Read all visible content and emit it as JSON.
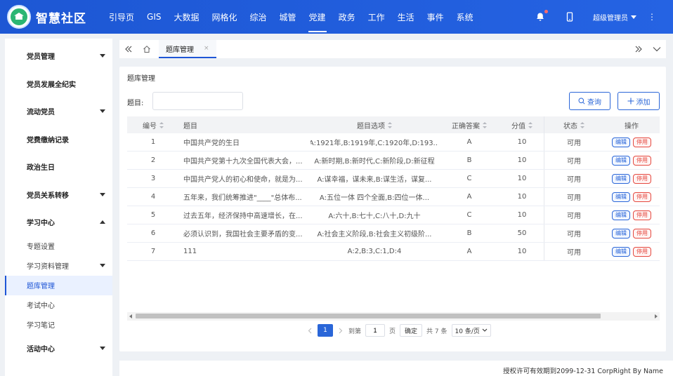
{
  "header": {
    "title": "智慧社区",
    "nav": [
      "引导页",
      "GIS",
      "大数据",
      "网格化",
      "综治",
      "城管",
      "党建",
      "政务",
      "工作",
      "生活",
      "事件",
      "系统"
    ],
    "active_nav": "党建",
    "user": "超级管理员",
    "more": "⋮"
  },
  "sidebar": {
    "items": [
      {
        "label": "党员管理",
        "type": "main",
        "arrow": "down"
      },
      {
        "label": "党员发展全纪实",
        "type": "main"
      },
      {
        "label": "流动党员",
        "type": "main",
        "arrow": "down"
      },
      {
        "label": "党费缴纳记录",
        "type": "main"
      },
      {
        "label": "政治生日",
        "type": "main"
      },
      {
        "label": "党员关系转移",
        "type": "main",
        "arrow": "down"
      },
      {
        "label": "学习中心",
        "type": "main",
        "arrow": "up"
      },
      {
        "label": "专题设置",
        "type": "sub"
      },
      {
        "label": "学习资料管理",
        "type": "sub",
        "arrow": "down"
      },
      {
        "label": "题库管理",
        "type": "sub",
        "active": true
      },
      {
        "label": "考试中心",
        "type": "sub"
      },
      {
        "label": "学习笔记",
        "type": "sub"
      },
      {
        "label": "活动中心",
        "type": "main",
        "arrow": "down"
      }
    ]
  },
  "tabs": {
    "current": "题库管理",
    "close": "×"
  },
  "card": {
    "title": "题库管理",
    "search_label": "题目:",
    "search_value": "",
    "query_label": "查询",
    "add_label": "添加"
  },
  "table": {
    "headers": {
      "no": "编号",
      "title": "题目",
      "options": "题目选项",
      "answer": "正确答案",
      "score": "分值",
      "status": "状态",
      "ops": "操作"
    },
    "edit_label": "编辑",
    "stop_label": "停用",
    "rows": [
      {
        "no": "1",
        "title": "中国共产党的生日",
        "options": "A:1921年,B:1919年,C:1920年,D:193...",
        "answer": "A",
        "score": "10",
        "status": "可用"
      },
      {
        "no": "2",
        "title": "中国共产党第十九次全国代表大会，...",
        "options": "A:新时期,B:新时代,C:新阶段,D:新征程",
        "answer": "B",
        "score": "10",
        "status": "可用"
      },
      {
        "no": "3",
        "title": "中国共产党人的初心和使命，就是为...",
        "options": "A:谋幸福，谋未来,B:谋生活，谋复...",
        "answer": "C",
        "score": "10",
        "status": "可用"
      },
      {
        "no": "4",
        "title": "五年来，我们统筹推进\"____\"总体布...",
        "options": "A:五位一体   四个全面,B:四位一体...",
        "answer": "A",
        "score": "10",
        "status": "可用"
      },
      {
        "no": "5",
        "title": "过去五年，经济保持中高速增长，在...",
        "options": "A:六十,B:七十,C:八十,D:九十",
        "answer": "C",
        "score": "10",
        "status": "可用"
      },
      {
        "no": "6",
        "title": "必须认识到，我国社会主要矛盾的变...",
        "options": "A:社会主义阶段,B:社会主义初级阶...",
        "answer": "B",
        "score": "50",
        "status": "可用"
      },
      {
        "no": "7",
        "title": "111",
        "options": "A:2,B:3,C:1,D:4",
        "answer": "A",
        "score": "10",
        "status": "可用"
      }
    ]
  },
  "pager": {
    "current_page": "1",
    "goto_label": "到第",
    "goto_value": "1",
    "page_unit": "页",
    "confirm": "确定",
    "total": "共 7 条",
    "page_size": "10 条/页"
  },
  "footer": {
    "text": "授权许可有效期到2099-12-31 CorpRight By Name"
  }
}
